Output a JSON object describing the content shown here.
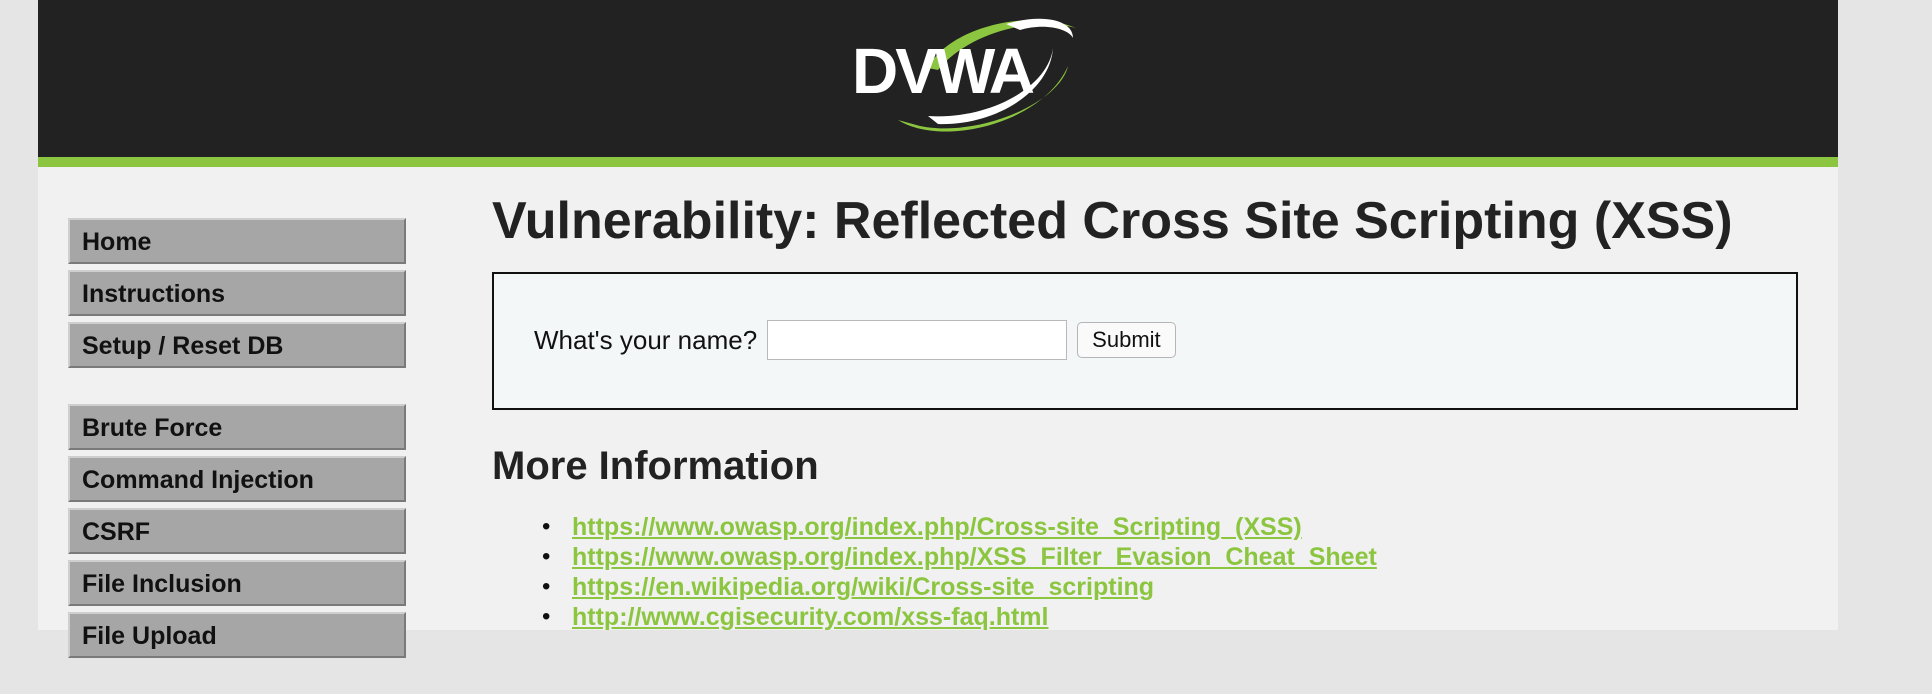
{
  "header": {
    "logo_text": "DVWA",
    "colors": {
      "background": "#222222",
      "accent": "#8cc53f"
    }
  },
  "sidebar": {
    "groups": [
      [
        "Home",
        "Instructions",
        "Setup / Reset DB"
      ],
      [
        "Brute Force",
        "Command Injection",
        "CSRF",
        "File Inclusion",
        "File Upload"
      ]
    ]
  },
  "main": {
    "title": "Vulnerability: Reflected Cross Site Scripting (XSS)",
    "form": {
      "label": "What's your name?",
      "input_value": "",
      "submit_label": "Submit"
    },
    "more_info": {
      "heading": "More Information",
      "links": [
        "https://www.owasp.org/index.php/Cross-site_Scripting_(XSS)",
        "https://www.owasp.org/index.php/XSS_Filter_Evasion_Cheat_Sheet",
        "https://en.wikipedia.org/wiki/Cross-site_scripting",
        "http://www.cgisecurity.com/xss-faq.html"
      ]
    }
  }
}
